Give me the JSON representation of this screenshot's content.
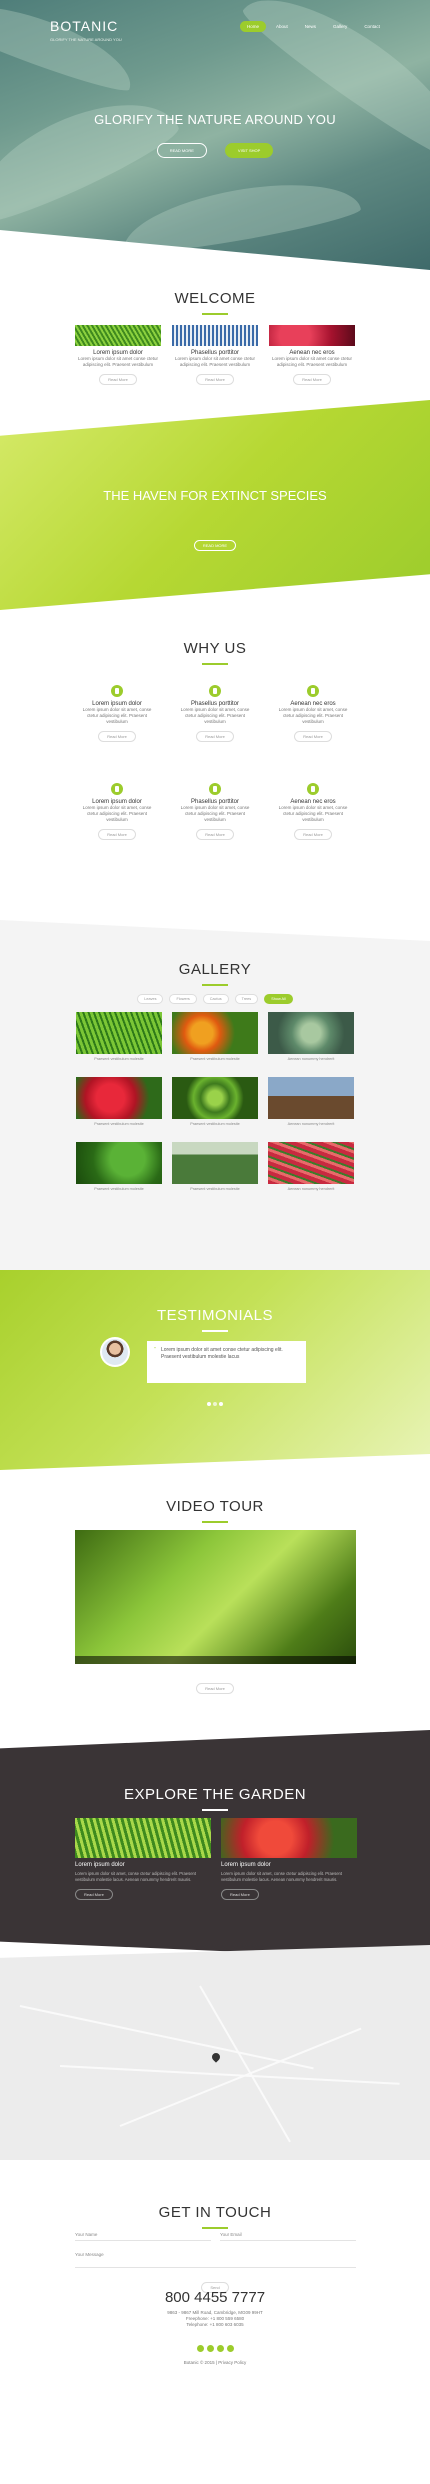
{
  "header": {
    "logo": "BOTANIC",
    "tagline": "GLORIFY THE NATURE AROUND YOU",
    "nav": [
      "Home",
      "About",
      "News",
      "Gallery",
      "Contact"
    ],
    "headline": "GLORIFY THE NATURE AROUND YOU",
    "btn_primary": "READ MORE",
    "btn_secondary": "VISIT SHOP",
    "accent": "#9ccc2c"
  },
  "welcome": {
    "title": "WELCOME",
    "cards": [
      {
        "title": "Lorem ipsum dolor",
        "text": "Lorem ipsum dolor sit amet conse ctetur adipiscing elit. Praesent vestibulum",
        "btn": "Read More"
      },
      {
        "title": "Phasellus porttitor",
        "text": "Lorem ipsum dolor sit amet conse ctetur adipiscing elit. Praesent vestibulum",
        "btn": "Read More"
      },
      {
        "title": "Aenean nec eros",
        "text": "Lorem ipsum dolor sit amet conse ctetur adipiscing elit. Praesent vestibulum",
        "btn": "Read More"
      }
    ]
  },
  "haven": {
    "title": "THE HAVEN FOR EXTINCT SPECIES",
    "btn": "READ MORE"
  },
  "why": {
    "title": "WHY US",
    "items": [
      {
        "title": "Lorem ipsum dolor",
        "text": "Lorem ipsum dolor sit amet, conse ctetur adipiscing elit. Praesent vestibulum",
        "btn": "Read More"
      },
      {
        "title": "Phasellus porttitor",
        "text": "Lorem ipsum dolor sit amet, conse ctetur adipiscing elit. Praesent vestibulum",
        "btn": "Read More"
      },
      {
        "title": "Aenean nec eros",
        "text": "Lorem ipsum dolor sit amet, conse ctetur adipiscing elit. Praesent vestibulum",
        "btn": "Read More"
      },
      {
        "title": "Lorem ipsum dolor",
        "text": "Lorem ipsum dolor sit amet, conse ctetur adipiscing elit. Praesent vestibulum",
        "btn": "Read More"
      },
      {
        "title": "Phasellus porttitor",
        "text": "Lorem ipsum dolor sit amet, conse ctetur adipiscing elit. Praesent vestibulum",
        "btn": "Read More"
      },
      {
        "title": "Aenean nec eros",
        "text": "Lorem ipsum dolor sit amet, conse ctetur adipiscing elit. Praesent vestibulum",
        "btn": "Read More"
      }
    ]
  },
  "gallery": {
    "title": "GALLERY",
    "tabs": [
      "Leaves",
      "Flowers",
      "Cactus",
      "Trees",
      "Show All"
    ],
    "captions": [
      "Praesent vestibulum molestie",
      "Praesent vestibulum molestie",
      "Aenean nonummy hendrerit",
      "Praesent vestibulum molestie",
      "Praesent vestibulum molestie",
      "Aenean nonummy hendrerit",
      "Praesent vestibulum molestie",
      "Praesent vestibulum molestie",
      "Aenean nonummy hendrerit"
    ]
  },
  "testimonials": {
    "title": "TESTIMONIALS",
    "quote": "Lorem ipsum dolor sit amet conse ctetur adipiscing elit. Praesent vestibulum molestie lacus"
  },
  "video": {
    "title": "VIDEO TOUR",
    "btn": "Read More"
  },
  "explore": {
    "title": "EXPLORE THE GARDEN",
    "items": [
      {
        "title": "Lorem ipsum dolor",
        "text": "Lorem ipsum dolor sit amet, conse ctetur adipiscing elit. Praesent vestibulum molestie lacus. Aenean nonummy hendrerit mauris.",
        "btn": "Read More"
      },
      {
        "title": "Lorem ipsum dolor",
        "text": "Lorem ipsum dolor sit amet, conse ctetur adipiscing elit. Praesent vestibulum molestie lacus. Aenean nonummy hendrerit mauris.",
        "btn": "Read More"
      }
    ]
  },
  "contact": {
    "title": "GET IN TOUCH",
    "name_placeholder": "Your Name",
    "email_placeholder": "Your Email",
    "message_placeholder": "Your Message",
    "submit": "Send",
    "phone": "800 4455 7777",
    "address": "9863 - 9867 Mill Road, Cambridge, MG09 99HT",
    "freephone": "Freephone: +1 800 559 6580",
    "telephone": "Telephone: +1 800 603 6035",
    "copyright": "Botanic © 2015 | Privacy Policy"
  }
}
